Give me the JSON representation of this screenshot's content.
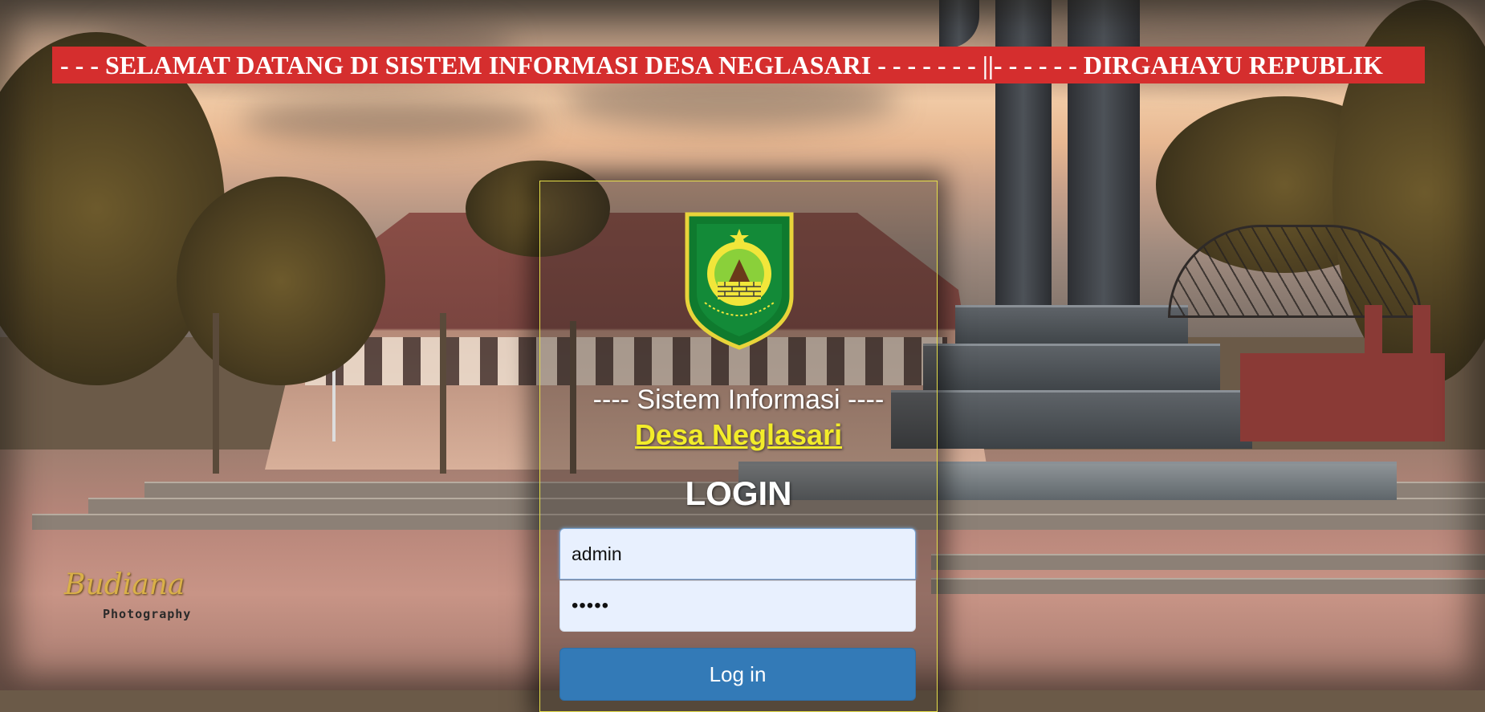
{
  "banner": {
    "text": "- - - SELAMAT DATANG DI SISTEM INFORMASI DESA NEGLASARI - - - - - - - ||- - - - - - DIRGAHAYU REPUBLIK"
  },
  "watermark": {
    "script": "Budiana",
    "sub": "Photography"
  },
  "login": {
    "logo_icon": "benteng-pancasila-emblem",
    "subtitle": "---- Sistem Informasi ----",
    "village_name": "Desa Neglasari",
    "title": "LOGIN",
    "username_value": "admin",
    "password_value": "admin",
    "button_label": "Log in"
  },
  "colors": {
    "banner_bg": "#d52e2e",
    "village_name": "#f2ec2a",
    "button_bg": "#337ab7",
    "input_bg": "#e8f0fe",
    "panel_border": "#e6df4a"
  }
}
